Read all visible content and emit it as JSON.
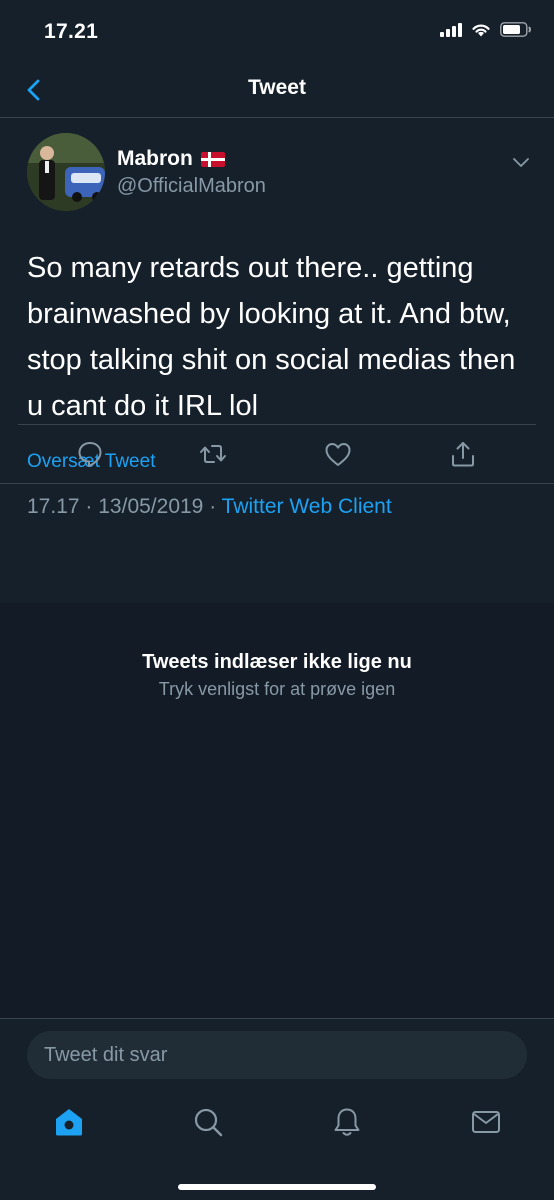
{
  "status_bar": {
    "time": "17.21"
  },
  "nav": {
    "title": "Tweet"
  },
  "tweet": {
    "display_name": "Mabron",
    "handle": "@OfficialMabron",
    "text": "So many retards out there.. getting brainwashed by looking at it. And btw, stop talking shit on social medias then u cant do it IRL lol",
    "translate_label": "Oversæt Tweet",
    "time": "17.17",
    "date": "13/05/2019",
    "separator": "·",
    "source": "Twitter Web Client"
  },
  "error": {
    "title": "Tweets indlæser ikke lige nu",
    "subtitle": "Tryk venligst for at prøve igen"
  },
  "reply": {
    "placeholder": "Tweet dit svar"
  },
  "colors": {
    "background": "#15202b",
    "accent": "#1da1f2",
    "muted": "#8899a6",
    "divider": "#38444d"
  },
  "icons": {
    "status": [
      "signal-icon",
      "wifi-icon",
      "battery-icon"
    ],
    "actions": [
      "reply-icon",
      "retweet-icon",
      "like-icon",
      "share-icon"
    ],
    "tabs": [
      "home-icon",
      "search-icon",
      "notifications-icon",
      "messages-icon"
    ]
  }
}
